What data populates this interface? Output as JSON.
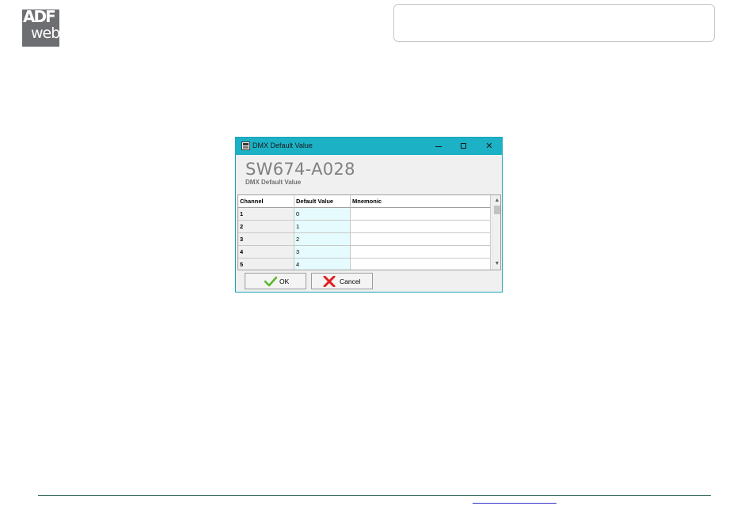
{
  "logo": {
    "line1": "ADF",
    "line2": "web"
  },
  "dialog": {
    "title": "DMX Default Value",
    "controls": {
      "minimize": "—",
      "maximize": "□",
      "close": "✕"
    },
    "product_code": "SW674-A028",
    "subtitle": "DMX Default Value",
    "table": {
      "headers": [
        "Channel",
        "Default Value",
        "Mnemonic"
      ],
      "rows": [
        {
          "channel": "1",
          "default": "0",
          "mnemonic": ""
        },
        {
          "channel": "2",
          "default": "1",
          "mnemonic": ""
        },
        {
          "channel": "3",
          "default": "2",
          "mnemonic": ""
        },
        {
          "channel": "4",
          "default": "3",
          "mnemonic": ""
        },
        {
          "channel": "5",
          "default": "4",
          "mnemonic": ""
        }
      ]
    },
    "scroll": {
      "up": "▲",
      "down": "▼"
    },
    "buttons": {
      "ok": "OK",
      "cancel": "Cancel"
    }
  },
  "colors": {
    "titlebar": "#1cb1c5",
    "default_cell": "#e6fbfd",
    "footer_line": "#1f5a4f",
    "ok_check": "#5cb82a",
    "cancel_x": "#e02020"
  }
}
